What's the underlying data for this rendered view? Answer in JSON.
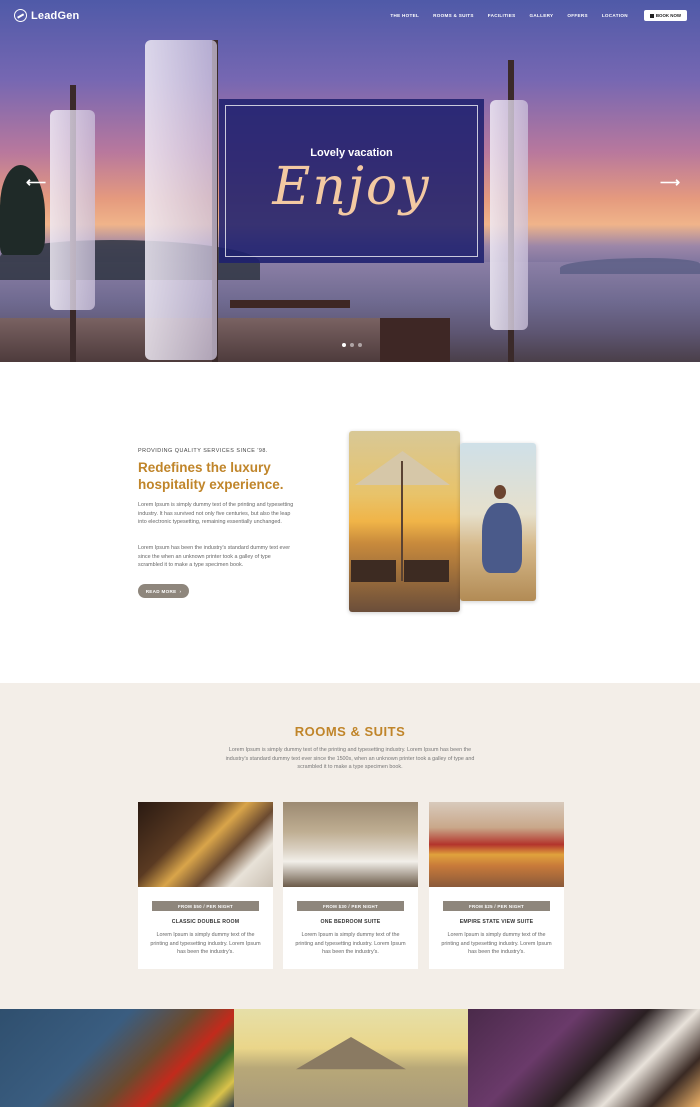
{
  "header": {
    "logo_text": "LeadGen",
    "nav": [
      "THE HOTEL",
      "ROOMS & SUITS",
      "FACILITIES",
      "GALLERY",
      "OFFERS",
      "LOCATION"
    ],
    "book_label": "BOOK NOW"
  },
  "hero": {
    "subtitle": "Lovely vacation",
    "title": "Enjoy",
    "prev_arrow": "⟵",
    "next_arrow": "⟶",
    "slide_count": 3,
    "active_slide": 1
  },
  "about": {
    "kicker": "PROVIDING QUALITY SERVICES SINCE '98.",
    "title": "Redefines the luxury hospitality experience.",
    "paragraph1": "Lorem Ipsum is simply dummy text of the printing and typesetting industry. It has survived not only five centuries, but also the leap into electronic typesetting, remaining essentially unchanged.",
    "paragraph2": "Lorem Ipsum has been the industry's standard dummy text ever since the when an unknown printer took a galley of type scrambled it to make a type specimen book.",
    "read_more": "READ MORE"
  },
  "rooms": {
    "title": "ROOMS & SUITS",
    "description": "Lorem Ipsum is simply dummy text of the printing and typesetting industry. Lorem Ipsum has been the industry's standard dummy text ever since the 1500s, when an unknown printer took a galley of type and scrambled it to make a type specimen book.",
    "cards": [
      {
        "price": "FROM $50 / PER NIGHT",
        "name": "CLASSIC DOUBLE ROOM",
        "text": "Lorem Ipsum is simply dummy text of the printing and typesetting industry. Lorem Ipsum has been the industry's."
      },
      {
        "price": "FROM $30 / PER NIGHT",
        "name": "ONE BEDROOM SUITE",
        "text": "Lorem Ipsum is simply dummy text of the printing and typesetting industry. Lorem Ipsum has been the industry's."
      },
      {
        "price": "FROM $25 / PER NIGHT",
        "name": "EMPIRE STATE VIEW SUITE",
        "text": "Lorem Ipsum is simply dummy text of the printing and typesetting industry. Lorem Ipsum has been the industry's."
      }
    ]
  },
  "colors": {
    "accent": "#c0852a",
    "button": "#8e867c",
    "hero_box": "#1e206e",
    "section_bg": "#f3eee8"
  }
}
